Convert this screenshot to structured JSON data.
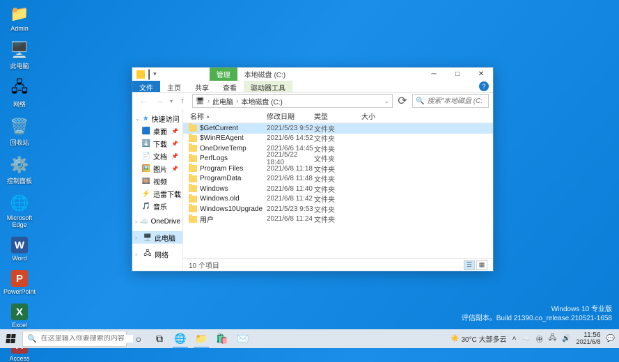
{
  "desktop": {
    "icons": [
      {
        "name": "admin",
        "label": "Admin",
        "glyph": "📁",
        "color": "#ffd666"
      },
      {
        "name": "thispc",
        "label": "此电脑",
        "glyph": "🖥️",
        "color": ""
      },
      {
        "name": "network",
        "label": "网络",
        "glyph": "🖧",
        "color": ""
      },
      {
        "name": "recyclebin",
        "label": "回收站",
        "glyph": "🗑️",
        "color": ""
      },
      {
        "name": "controlpanel",
        "label": "控制面板",
        "glyph": "⚙️",
        "color": ""
      },
      {
        "name": "edge",
        "label": "Microsoft Edge",
        "glyph": "🌐",
        "color": "#0b88da"
      },
      {
        "name": "word",
        "label": "Word",
        "glyph": "W",
        "color": "#2b579a"
      },
      {
        "name": "powerpoint",
        "label": "PowerPoint",
        "glyph": "P",
        "color": "#d24726"
      },
      {
        "name": "excel",
        "label": "Excel",
        "glyph": "X",
        "color": "#217346"
      },
      {
        "name": "access",
        "label": "Access",
        "glyph": "A",
        "color": "#a4373a"
      }
    ]
  },
  "explorer": {
    "qat": {
      "sep": "|",
      "dd": "▾"
    },
    "context_tabs": {
      "manage": "管理",
      "drive": "本地磁盘 (C:)"
    },
    "wincontrols": {
      "min": "─",
      "max": "□",
      "close": "✕"
    },
    "ribbon": {
      "file": "文件",
      "home": "主页",
      "share": "共享",
      "view": "查看",
      "drive_tools": "驱动器工具",
      "help": "?"
    },
    "nav": {
      "back": "←",
      "fwd": "→",
      "up": "↑",
      "refresh": "⟳"
    },
    "breadcrumb": {
      "pcicon": "🖥",
      "root": "此电脑",
      "sep": "›",
      "current": "本地磁盘 (C:)"
    },
    "search": {
      "icon": "🔍",
      "placeholder": "搜索\"本地磁盘 (C:)\""
    },
    "tree": {
      "quick": "快速访问",
      "desktop": "桌面",
      "downloads": "下载",
      "documents": "文档",
      "pictures": "图片",
      "videos": "视频",
      "thunder": "迅雷下载",
      "music": "音乐",
      "onedrive": "OneDrive",
      "thispc": "此电脑",
      "network": "网络",
      "exp_open": "⌄",
      "exp_closed": "›",
      "star": "★",
      "pin": "📌"
    },
    "columns": {
      "name": "名称",
      "date": "修改日期",
      "type": "类型",
      "size": "大小",
      "sort": "▴"
    },
    "rows": [
      {
        "name": "$GetCurrent",
        "date": "2021/5/23 9:52",
        "type": "文件夹",
        "selected": true
      },
      {
        "name": "$WinREAgent",
        "date": "2021/6/6 14:52",
        "type": "文件夹"
      },
      {
        "name": "OneDriveTemp",
        "date": "2021/6/6 14:45",
        "type": "文件夹"
      },
      {
        "name": "PerfLogs",
        "date": "2021/5/22 18:40",
        "type": "文件夹"
      },
      {
        "name": "Program Files",
        "date": "2021/6/8 11:18",
        "type": "文件夹"
      },
      {
        "name": "ProgramData",
        "date": "2021/6/8 11:48",
        "type": "文件夹"
      },
      {
        "name": "Windows",
        "date": "2021/6/8 11:40",
        "type": "文件夹"
      },
      {
        "name": "Windows.old",
        "date": "2021/6/8 11:42",
        "type": "文件夹"
      },
      {
        "name": "Windows10Upgrade",
        "date": "2021/5/23 9:53",
        "type": "文件夹"
      },
      {
        "name": "用户",
        "date": "2021/6/8 11:24",
        "type": "文件夹"
      }
    ],
    "status": {
      "count": "10 个项目"
    }
  },
  "watermark": {
    "line1": "Windows 10 专业版",
    "line2": "评估副本。Build 21390.co_release.210521-1658"
  },
  "taskbar": {
    "search_placeholder": "在这里输入你要搜索的内容",
    "weather": {
      "icon": "☀️",
      "text": "30°C  大部多云"
    },
    "tray_up": "˄",
    "clock": {
      "time": "11:56",
      "date": "2021/6/8"
    }
  }
}
